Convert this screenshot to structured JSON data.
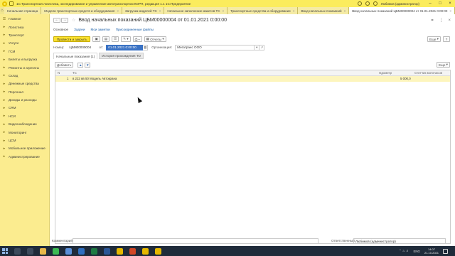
{
  "app": {
    "title": "1С:Транспортная логистика, экспедирование и управление автотранспортом КОРП, редакция 1.1 1С:Предприятие",
    "user": "Любимов (администратор)",
    "colors": {
      "titlebar": "#fbec5d",
      "sidebar": "#fbec8f",
      "primary_button": "#fbe12c",
      "selected_row": "#fdf5bd",
      "link": "#1a5fa8"
    }
  },
  "tabs": [
    {
      "label": "Начальная страница",
      "active": false
    },
    {
      "label": "Модели транспортных средств и оборудования",
      "active": false
    },
    {
      "label": "Загрузка моделей ТС",
      "active": false
    },
    {
      "label": "Начальное заполнение макетов ТС",
      "active": false
    },
    {
      "label": "Транспортные средства и оборудование",
      "active": false
    },
    {
      "label": "Ввод начальных показаний",
      "active": false
    },
    {
      "label": "Ввод начальных показаний ЦБМ00000004 от 01.01.2021 0:00:00",
      "active": true
    }
  ],
  "sidebar": {
    "items": [
      {
        "label": "Главное",
        "icon": "menu-icon"
      },
      {
        "label": "Логистика",
        "icon": "logistics-icon"
      },
      {
        "label": "Транспорт",
        "icon": "truck-icon"
      },
      {
        "label": "Услуги",
        "icon": "services-icon"
      },
      {
        "label": "ГСМ",
        "icon": "fuel-icon"
      },
      {
        "label": "Билеты и выгрузка",
        "icon": "tickets-icon"
      },
      {
        "label": "Ремонты и агрегаты",
        "icon": "wrench-icon"
      },
      {
        "label": "Склад",
        "icon": "warehouse-icon"
      },
      {
        "label": "Денежные средства",
        "icon": "money-icon"
      },
      {
        "label": "Персонал",
        "icon": "people-icon"
      },
      {
        "label": "Доходы и расходы",
        "icon": "income-icon"
      },
      {
        "label": "CRM",
        "icon": "crm-icon"
      },
      {
        "label": "НСИ",
        "icon": "reference-icon"
      },
      {
        "label": "Видеонаблюдение",
        "icon": "camera-icon"
      },
      {
        "label": "Мониторинг",
        "icon": "monitor-icon"
      },
      {
        "label": "ЦСМ",
        "icon": "gear-icon"
      },
      {
        "label": "Мобильное приложение",
        "icon": "mobile-icon"
      },
      {
        "label": "Администрирование",
        "icon": "admin-icon"
      }
    ]
  },
  "form": {
    "title": "Ввод начальных показаний ЦБМ00000004 от 01.01.2021 0:00:00",
    "links": [
      {
        "label": "Основное",
        "active": true
      },
      {
        "label": "Задачи",
        "active": false
      },
      {
        "label": "Мои заметки",
        "active": false
      },
      {
        "label": "Присоединенные файлы",
        "active": false
      }
    ],
    "toolbar": {
      "post_close": "Провести и закрыть",
      "reports": "Отчеты",
      "more": "Еще"
    },
    "fields": {
      "number_label": "Номер:",
      "number_value": "ЦБМ00000004",
      "date_label": "от:",
      "date_value": "01.01.2021 0:00:00",
      "org_label": "Организация:",
      "org_value": "Мегатранс ООО"
    },
    "subtabs": [
      {
        "label": "Начальные показания (1)",
        "active": true
      },
      {
        "label": "История прохождения ТО",
        "active": false
      }
    ],
    "table": {
      "add_button": "Добавить",
      "more": "Еще",
      "columns": {
        "n": "N",
        "vehicle": "ТС",
        "odometer": "Одометр",
        "engine_hours": "Счетчик моточасов"
      },
      "rows": [
        {
          "n": "1",
          "vehicle": "в 222 вв 50 Модель Автокрана",
          "odometer": "5 000,0",
          "engine_hours": ""
        }
      ]
    },
    "footer": {
      "comment_label": "Комментарий:",
      "comment_value": "",
      "responsible_label": "Ответственный:",
      "responsible_value": "Любимов (администратор)"
    }
  },
  "taskbar": {
    "lang": "ENG",
    "time": "14:07",
    "date": "21.10.2021",
    "apps": [
      {
        "icon": "search-icon",
        "color": "#3d4b5c"
      },
      {
        "icon": "taskview-icon",
        "color": "#3d4b5c"
      },
      {
        "icon": "folder-icon",
        "color": "#e8b84a"
      },
      {
        "icon": "chrome-icon",
        "color": "#3cba54"
      },
      {
        "icon": "store-icon",
        "color": "#5a8fd8"
      },
      {
        "icon": "mail-icon",
        "color": "#2f6fc0"
      },
      {
        "icon": "excel-icon",
        "color": "#1f7a43"
      },
      {
        "icon": "word-icon",
        "color": "#2b5797"
      },
      {
        "icon": "1c-icon",
        "color": "#e6b800"
      },
      {
        "icon": "powerpoint-icon",
        "color": "#d24726"
      },
      {
        "icon": "1c-icon",
        "color": "#e6b800"
      },
      {
        "icon": "1c-icon",
        "color": "#e6b800"
      }
    ]
  }
}
